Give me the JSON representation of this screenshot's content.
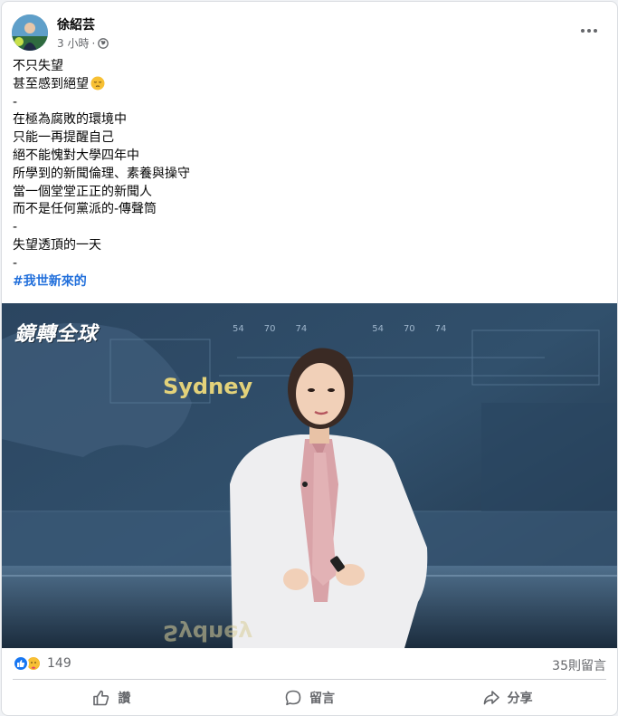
{
  "post": {
    "author": "徐紹芸",
    "time": "3 小時",
    "separator": "·",
    "privacy_icon": "globe-icon",
    "body_lines": [
      "不只失望",
      "甚至感到絕望",
      "-",
      "在極為腐敗的環境中",
      "只能一再提醒自己",
      "絕不能愧對大學四年中",
      "所學到的新聞倫理、素養與操守",
      "當一個堂堂正正的新聞人",
      "而不是任何黨派的-傳聲筒",
      "-",
      "失望透頂的一天",
      "-"
    ],
    "hashtag": "#我世新來的"
  },
  "media": {
    "logo": "鏡轉全球",
    "city_label": "Sydney",
    "ticker_numbers": [
      "54",
      "70",
      "74",
      "54",
      "70",
      "74"
    ]
  },
  "stats": {
    "reaction_icons": [
      "like-icon",
      "care-icon"
    ],
    "reaction_count": "149",
    "comment_count": "35則留言"
  },
  "actions": {
    "like": "讚",
    "comment": "留言",
    "share": "分享"
  },
  "colors": {
    "hashtag": "#216fdb",
    "like_blue": "#1877f2",
    "secondary_text": "#65676b"
  }
}
